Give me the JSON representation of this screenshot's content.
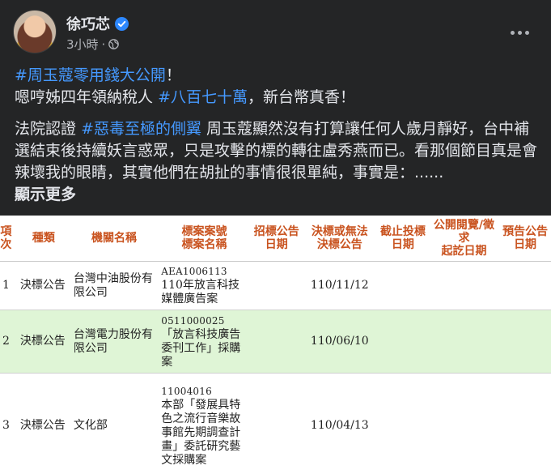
{
  "post": {
    "author": "徐巧芯",
    "time": "3小時",
    "dot": "·",
    "line1_tag": "#周玉蔻零用錢大公開",
    "line1_end": "！",
    "line2_a": "嗯哼姊四年領納稅人",
    "line2_tag": "#八百七十萬",
    "line2_b": "，新台幣真香！",
    "p2_a": "法院認證",
    "p2_tag": "#惡毒至極的側翼",
    "p2_b": "周玉蔻顯然沒有打算讓任何人歲月靜好，台中補選結束後持續妖言惑眾，只是攻擊的標的轉往盧秀燕而已。看那個節目真是會辣壞我的眼睛，其實他們在胡扯的事情很很單純，事實是：......",
    "see_more": "顯示更多"
  },
  "table": {
    "headers": [
      "項次",
      "種類",
      "機關名稱",
      "標案案號\n標案名稱",
      "招標公告日期",
      "決標或無法\n決標公告",
      "截止投標日期",
      "公開閱覽/徵求\n起訖日期",
      "預告公告日期"
    ],
    "rows": [
      {
        "no": "1",
        "type": "決標公告",
        "org": "台灣中油股份有限公司",
        "case_no": "AEA1006113",
        "case_name": "110年放言科技媒體廣告案",
        "award_date": "110/11/12"
      },
      {
        "no": "2",
        "type": "決標公告",
        "org": "台灣電力股份有限公司",
        "case_no": "0511000025",
        "case_name": "「放言科技廣告委刊工作」採購案",
        "award_date": "110/06/10"
      },
      {
        "no": "3",
        "type": "決標公告",
        "org": "文化部",
        "case_no": "11004016",
        "case_name": "本部「發展具特色之流行音樂故事館先期調查計畫」委託研究藝文採購案",
        "award_date": "110/04/13"
      }
    ]
  },
  "colors": {
    "hashtag": "#4599ff",
    "header_text": "#c9531f",
    "alt_row": "#dff5d6"
  }
}
